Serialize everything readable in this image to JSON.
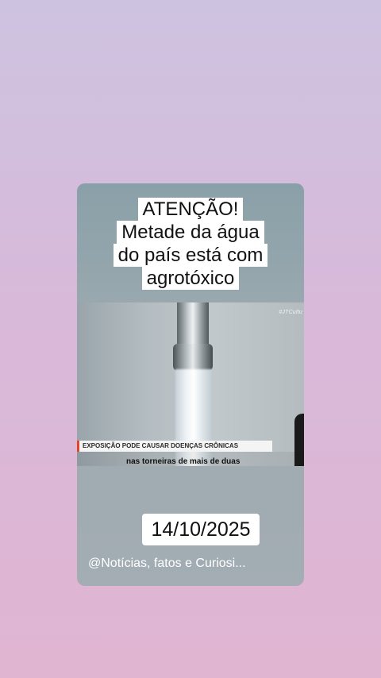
{
  "post": {
    "headline": [
      "ATENÇÃO!",
      "Metade da água",
      "do país está com",
      "agrotóxico"
    ],
    "video": {
      "channel_tag": "#JTCultu",
      "lower_third": "EXPOSIÇÃO PODE CAUSAR DOENÇAS CRÔNICAS",
      "subtitle": "nas torneiras de mais de duas"
    },
    "date": "14/10/2025",
    "watermark": "@Notícias, fatos e Curiosi..."
  },
  "colors": {
    "lower_third_accent": "#e0452b",
    "headline_bg": "#ffffff"
  }
}
